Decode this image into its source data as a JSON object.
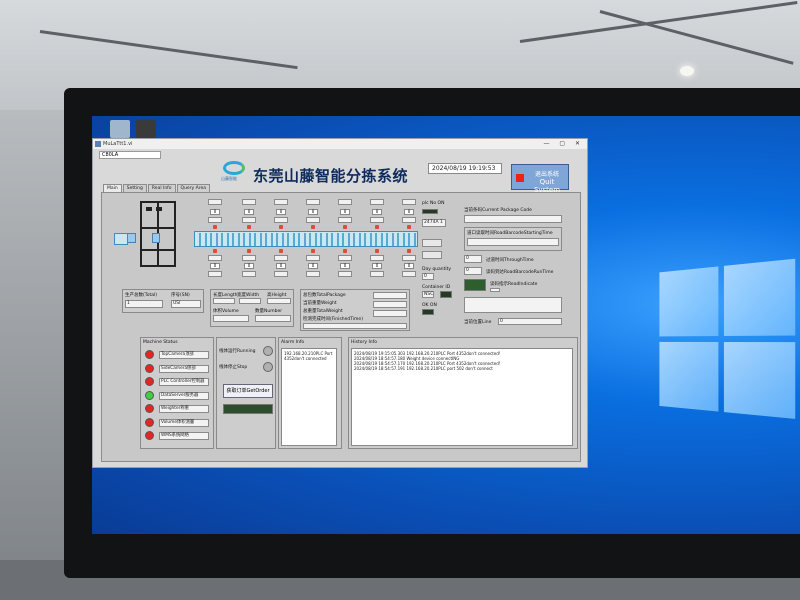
{
  "window": {
    "title": "MuLaTtt1.vi",
    "path_field": "C80LA",
    "logo_text": "山藤智能",
    "app_title": "东莞山藤智能分拣系统",
    "datetime": "2024/08/19 19:19:53",
    "quit_cn": "退出系统",
    "quit_en": "Quit System"
  },
  "tabs": [
    {
      "label": "Main",
      "active": true
    },
    {
      "label": "Setting",
      "active": false
    },
    {
      "label": "Real Info",
      "active": false
    },
    {
      "label": "Query Area",
      "active": false
    }
  ],
  "sorter": {
    "outlet_numbers_top": [
      "0",
      "0",
      "0",
      "0",
      "0",
      "0",
      "0"
    ],
    "outlet_numbers_bottom": [
      "0",
      "0",
      "0",
      "0",
      "0",
      "0",
      "0"
    ]
  },
  "totals": {
    "total_label": "生产总数(Total)",
    "total_value": "1",
    "serial_label": "序号(SN)",
    "serial_value": "USI"
  },
  "sizes": {
    "length_label": "长度Length",
    "width_label": "宽度Width",
    "height_label": "高Height",
    "volume_label": "体积Volume",
    "number_label": "数量Number"
  },
  "package": {
    "total_package_label": "总包数TotalPackage",
    "weight_label": "当前重量Weight",
    "total_weight_label": "总重量TotalWeight",
    "time_label": "检测完成时间(FinishedTime)"
  },
  "plc": {
    "ok_label": "plc No ON",
    "value": "2474A 1",
    "day_quantity_label": "Day quantity",
    "day_quantity_value": "0",
    "container_id_label": "Container ID",
    "container_id_value": "NSC",
    "ok_on_label": "OK ON"
  },
  "right": {
    "current_code_label": "当前条码Current Package Code",
    "road_barcode_label": "道口读取时间RoadBarcodeStartingTime",
    "through_time_label": "过道时间ThroughTime",
    "road_run_time_label": "读码到达RoadBarcodeRunTime",
    "read_indicate_label": "读码指示ReadIndicate",
    "line_label": "当前位置Line",
    "line_value": "0",
    "through_value": "0",
    "run_value": "0"
  },
  "machine_status": {
    "title": "Machine Status",
    "items": [
      {
        "label": "TopCamera顶部",
        "status": "error"
      },
      {
        "label": "SideCamera侧部",
        "status": "error"
      },
      {
        "label": "PLC Controller控制器",
        "status": "error"
      },
      {
        "label": "DataServer服务器",
        "status": "ok"
      },
      {
        "label": "Weighter称重",
        "status": "error"
      },
      {
        "label": "Volume体积测量",
        "status": "error"
      },
      {
        "label": "WMS系统网络",
        "status": "error"
      }
    ]
  },
  "controls": {
    "running_label": "线体运行Running",
    "stop_label": "线体停止Stop",
    "get_order_label": "获取订单GetOrder"
  },
  "alarm": {
    "title": "Alarm Info",
    "lines": [
      "192.168.20.210PLC Port",
      "4352don't connected"
    ]
  },
  "history": {
    "title": "History Info",
    "lines": [
      "2024/08/19 19:15:05.303  192.168.20.210PLC Port 4352don't connected!",
      "2024/08/19 18:54:57.180  Weight device connectING",
      "2024/08/19 18:54:57.170  192.168.20.210PLC Port 4352don't connected!",
      "2024/08/19 18:54:57.191  192.168.20.210PLC port 502 don't connect"
    ]
  },
  "colors": {
    "led_ok": "#3fcf3f",
    "led_error": "#e8241c",
    "accent": "#7fa6d6"
  }
}
